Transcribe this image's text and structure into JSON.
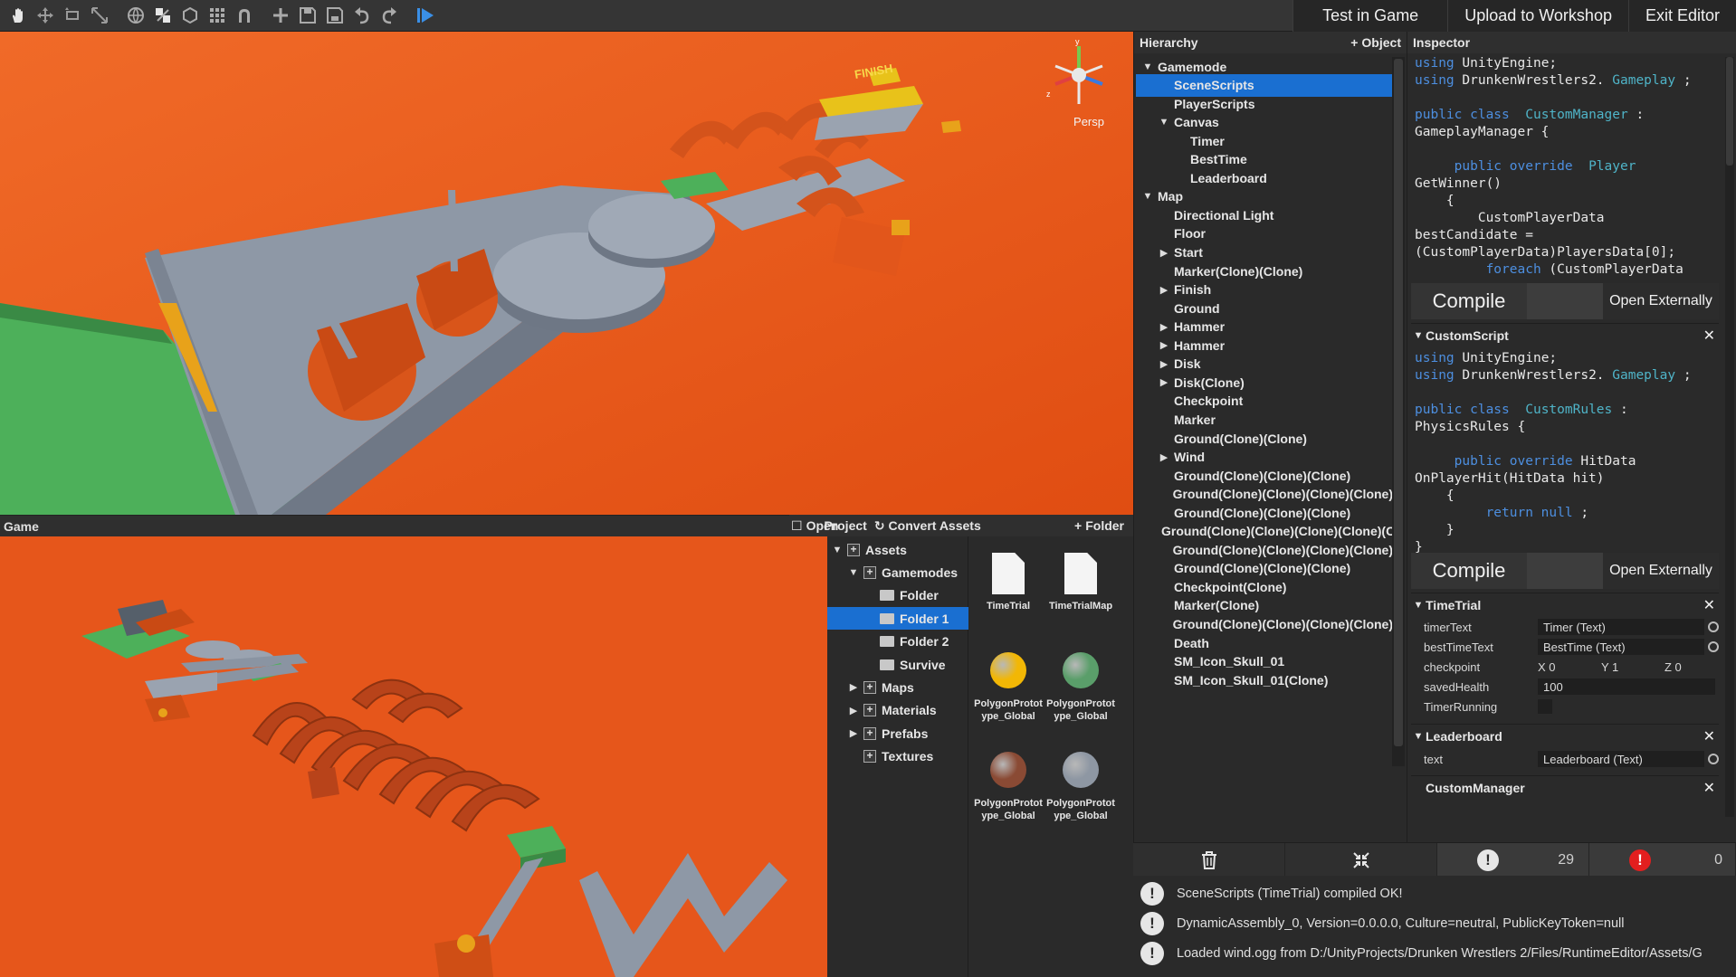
{
  "toolbar": {
    "tools": [
      "hand-icon",
      "move-icon",
      "rotate-icon",
      "scale-icon",
      "globe-icon",
      "pivot-icon",
      "snap-icon",
      "grid-icon",
      "magnet-icon",
      "add-icon",
      "save-icon",
      "save-as-icon",
      "undo-icon",
      "redo-icon",
      "play-icon"
    ],
    "test_in_game": "Test in Game",
    "upload": "Upload to Workshop",
    "exit": "Exit Editor"
  },
  "scene": {
    "persp_label": "Persp",
    "finish_sign": "FINISH",
    "gizmo_y": "y",
    "gizmo_z": "z"
  },
  "game": {
    "title": "Game"
  },
  "project": {
    "open_label": "Open",
    "title": "Project",
    "convert_label": "Convert Assets",
    "folder_label": "Folder",
    "tree": [
      {
        "label": "Assets",
        "level": 0,
        "arrow": "▼",
        "selected": false
      },
      {
        "label": "Gamemodes",
        "level": 1,
        "arrow": "▼",
        "selected": false
      },
      {
        "label": "Folder",
        "level": 2,
        "arrow": "",
        "selected": false
      },
      {
        "label": "Folder 1",
        "level": 2,
        "arrow": "",
        "selected": true
      },
      {
        "label": "Folder 2",
        "level": 2,
        "arrow": "",
        "selected": false
      },
      {
        "label": "Survive",
        "level": 2,
        "arrow": "",
        "selected": false
      },
      {
        "label": "Maps",
        "level": 1,
        "arrow": "▶",
        "selected": false
      },
      {
        "label": "Materials",
        "level": 1,
        "arrow": "▶",
        "selected": false
      },
      {
        "label": "Prefabs",
        "level": 1,
        "arrow": "▶",
        "selected": false
      },
      {
        "label": "Textures",
        "level": 1,
        "arrow": "",
        "selected": false
      }
    ],
    "assets": [
      {
        "name": "TimeTrial",
        "kind": "doc"
      },
      {
        "name": "TimeTrialMap",
        "kind": "doc"
      },
      {
        "name": "PolygonPrototype_Global",
        "kind": "ball",
        "color": "#f2b705"
      },
      {
        "name": "PolygonPrototype_Global",
        "kind": "ball",
        "color": "#5a9e6a"
      },
      {
        "name": "PolygonPrototype_Global",
        "kind": "ball",
        "color": "#8a4a34"
      },
      {
        "name": "PolygonPrototype_Global",
        "kind": "ball",
        "color": "#8e97a3"
      }
    ]
  },
  "hierarchy": {
    "title": "Hierarchy",
    "object_label": "Object",
    "items": [
      {
        "label": "Gamemode",
        "level": 0,
        "arrow": "▼",
        "selected": false
      },
      {
        "label": "SceneScripts",
        "level": 1,
        "arrow": "",
        "selected": true
      },
      {
        "label": "PlayerScripts",
        "level": 1,
        "arrow": "",
        "selected": false
      },
      {
        "label": "Canvas",
        "level": 1,
        "arrow": "▼",
        "selected": false
      },
      {
        "label": "Timer",
        "level": 2,
        "arrow": "",
        "selected": false
      },
      {
        "label": "BestTime",
        "level": 2,
        "arrow": "",
        "selected": false
      },
      {
        "label": "Leaderboard",
        "level": 2,
        "arrow": "",
        "selected": false
      },
      {
        "label": "Map",
        "level": 0,
        "arrow": "▼",
        "selected": false
      },
      {
        "label": "Directional Light",
        "level": 1,
        "arrow": "",
        "selected": false
      },
      {
        "label": "Floor",
        "level": 1,
        "arrow": "",
        "selected": false
      },
      {
        "label": "Start",
        "level": 1,
        "arrow": "▶",
        "selected": false
      },
      {
        "label": "Marker(Clone)(Clone)",
        "level": 1,
        "arrow": "",
        "selected": false
      },
      {
        "label": "Finish",
        "level": 1,
        "arrow": "▶",
        "selected": false
      },
      {
        "label": "Ground",
        "level": 1,
        "arrow": "",
        "selected": false
      },
      {
        "label": "Hammer",
        "level": 1,
        "arrow": "▶",
        "selected": false
      },
      {
        "label": "Hammer",
        "level": 1,
        "arrow": "▶",
        "selected": false
      },
      {
        "label": "Disk",
        "level": 1,
        "arrow": "▶",
        "selected": false
      },
      {
        "label": "Disk(Clone)",
        "level": 1,
        "arrow": "▶",
        "selected": false
      },
      {
        "label": "Checkpoint",
        "level": 1,
        "arrow": "",
        "selected": false
      },
      {
        "label": "Marker",
        "level": 1,
        "arrow": "",
        "selected": false
      },
      {
        "label": "Ground(Clone)(Clone)",
        "level": 1,
        "arrow": "",
        "selected": false
      },
      {
        "label": "Wind",
        "level": 1,
        "arrow": "▶",
        "selected": false
      },
      {
        "label": "Ground(Clone)(Clone)(Clone)",
        "level": 1,
        "arrow": "",
        "selected": false
      },
      {
        "label": "Ground(Clone)(Clone)(Clone)(Clone)",
        "level": 1,
        "arrow": "",
        "selected": false
      },
      {
        "label": "Ground(Clone)(Clone)(Clone)",
        "level": 1,
        "arrow": "",
        "selected": false
      },
      {
        "label": "Ground(Clone)(Clone)(Clone)(Clone)(C",
        "level": 1,
        "arrow": "",
        "selected": false
      },
      {
        "label": "Ground(Clone)(Clone)(Clone)(Clone)",
        "level": 1,
        "arrow": "",
        "selected": false
      },
      {
        "label": "Ground(Clone)(Clone)(Clone)",
        "level": 1,
        "arrow": "",
        "selected": false
      },
      {
        "label": "Checkpoint(Clone)",
        "level": 1,
        "arrow": "",
        "selected": false
      },
      {
        "label": "Marker(Clone)",
        "level": 1,
        "arrow": "",
        "selected": false
      },
      {
        "label": "Ground(Clone)(Clone)(Clone)(Clone)",
        "level": 1,
        "arrow": "",
        "selected": false
      },
      {
        "label": "Death",
        "level": 1,
        "arrow": "",
        "selected": false
      },
      {
        "label": "SM_Icon_Skull_01",
        "level": 1,
        "arrow": "",
        "selected": false
      },
      {
        "label": "SM_Icon_Skull_01(Clone)",
        "level": 1,
        "arrow": "",
        "selected": false
      }
    ]
  },
  "inspector": {
    "title": "Inspector",
    "code1": [
      [
        [
          "kw",
          "using"
        ],
        [
          "",
          "UnityEngine;"
        ]
      ],
      [
        [
          "kw",
          "using"
        ],
        [
          "",
          "DrunkenWrestlers2."
        ],
        [
          "ty",
          "Gameplay"
        ],
        [
          "",
          ";"
        ]
      ],
      [],
      [
        [
          "kw",
          "public class"
        ],
        [
          "",
          ""
        ],
        [
          "ty",
          "CustomManager"
        ],
        [
          "",
          ":"
        ]
      ],
      [
        [
          "",
          "GameplayManager {"
        ]
      ],
      [],
      [
        [
          "",
          "    "
        ],
        [
          "kw",
          "public override"
        ],
        [
          "",
          ""
        ],
        [
          "ty",
          "Player"
        ]
      ],
      [
        [
          "",
          "GetWinner()"
        ]
      ],
      [
        [
          "",
          "    {"
        ]
      ],
      [
        [
          "",
          "        CustomPlayerData"
        ]
      ],
      [
        [
          "",
          "bestCandidate ="
        ]
      ],
      [
        [
          "",
          "(CustomPlayerData)PlayersData[0];"
        ]
      ],
      [
        [
          "",
          "        "
        ],
        [
          "kw",
          "foreach"
        ],
        [
          "",
          "(CustomPlayerData"
        ]
      ]
    ],
    "compile": "Compile",
    "open_externally": "Open Externally",
    "custom_script_title": "CustomScript",
    "code2": [
      [
        [
          "kw",
          "using"
        ],
        [
          "",
          "UnityEngine;"
        ]
      ],
      [
        [
          "kw",
          "using"
        ],
        [
          "",
          "DrunkenWrestlers2."
        ],
        [
          "ty",
          "Gameplay"
        ],
        [
          "",
          ";"
        ]
      ],
      [],
      [
        [
          "kw",
          "public class"
        ],
        [
          "",
          ""
        ],
        [
          "ty",
          "CustomRules"
        ],
        [
          "",
          ":"
        ]
      ],
      [
        [
          "",
          "PhysicsRules {"
        ]
      ],
      [],
      [
        [
          "",
          "    "
        ],
        [
          "kw",
          "public override"
        ],
        [
          "",
          "HitData"
        ]
      ],
      [
        [
          "",
          "OnPlayerHit(HitData hit)"
        ]
      ],
      [
        [
          "",
          "    {"
        ]
      ],
      [
        [
          "",
          "        "
        ],
        [
          "kw",
          "return null"
        ],
        [
          "",
          ";"
        ]
      ],
      [
        [
          "",
          "    }"
        ]
      ],
      [
        [
          "",
          "}"
        ]
      ]
    ],
    "timetrial_title": "TimeTrial",
    "timetrial": {
      "timerText_label": "timerText",
      "timerText_value": "Timer (Text)",
      "bestTimeText_label": "bestTimeText",
      "bestTimeText_value": "BestTime (Text)",
      "checkpoint_label": "checkpoint",
      "checkpoint_x": "X 0",
      "checkpoint_y": "Y 1",
      "checkpoint_z": "Z 0",
      "savedHealth_label": "savedHealth",
      "savedHealth_value": "100",
      "timerRunning_label": "TimerRunning"
    },
    "leaderboard_title": "Leaderboard",
    "leaderboard": {
      "text_label": "text",
      "text_value": "Leaderboard (Text)"
    },
    "custommanager_title": "CustomManager"
  },
  "console": {
    "warning_count": "29",
    "error_count": "0",
    "logs": [
      "SceneScripts (TimeTrial) compiled OK!",
      "DynamicAssembly_0, Version=0.0.0.0, Culture=neutral, PublicKeyToken=null",
      "Loaded wind.ogg from D:/UnityProjects/Drunken Wrestlers 2/Files/RuntimeEditor/Assets/G"
    ]
  }
}
